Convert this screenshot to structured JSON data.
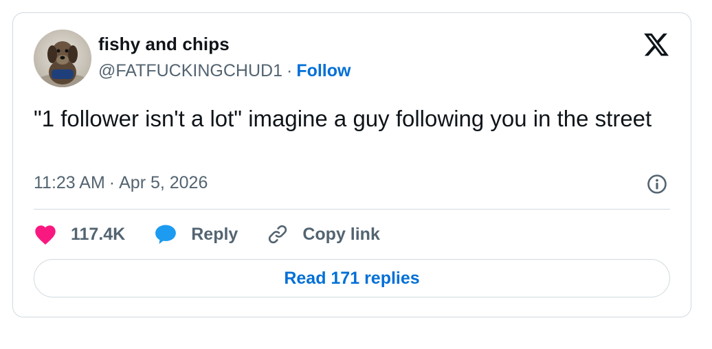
{
  "author": {
    "display_name": "fishy and chips",
    "handle": "@FATFUCKINGCHUD1",
    "separator": "·",
    "follow_label": "Follow"
  },
  "tweet": {
    "text": "\"1 follower isn't a lot\" imagine a guy following you in the street",
    "time": "11:23 AM",
    "separator": "·",
    "date": "Apr 5, 2026"
  },
  "actions": {
    "like_count": "117.4K",
    "reply_label": "Reply",
    "copy_link_label": "Copy link"
  },
  "read_replies_label": "Read 171 replies",
  "icons": {
    "logo": "x-logo-icon",
    "info": "info-icon",
    "like": "heart-icon",
    "reply": "speech-bubble-icon",
    "copy": "link-icon"
  },
  "colors": {
    "accent": "#006fd6",
    "like": "#f91880",
    "reply": "#1d9bf0",
    "muted": "#536471",
    "border": "#cfd9de"
  }
}
